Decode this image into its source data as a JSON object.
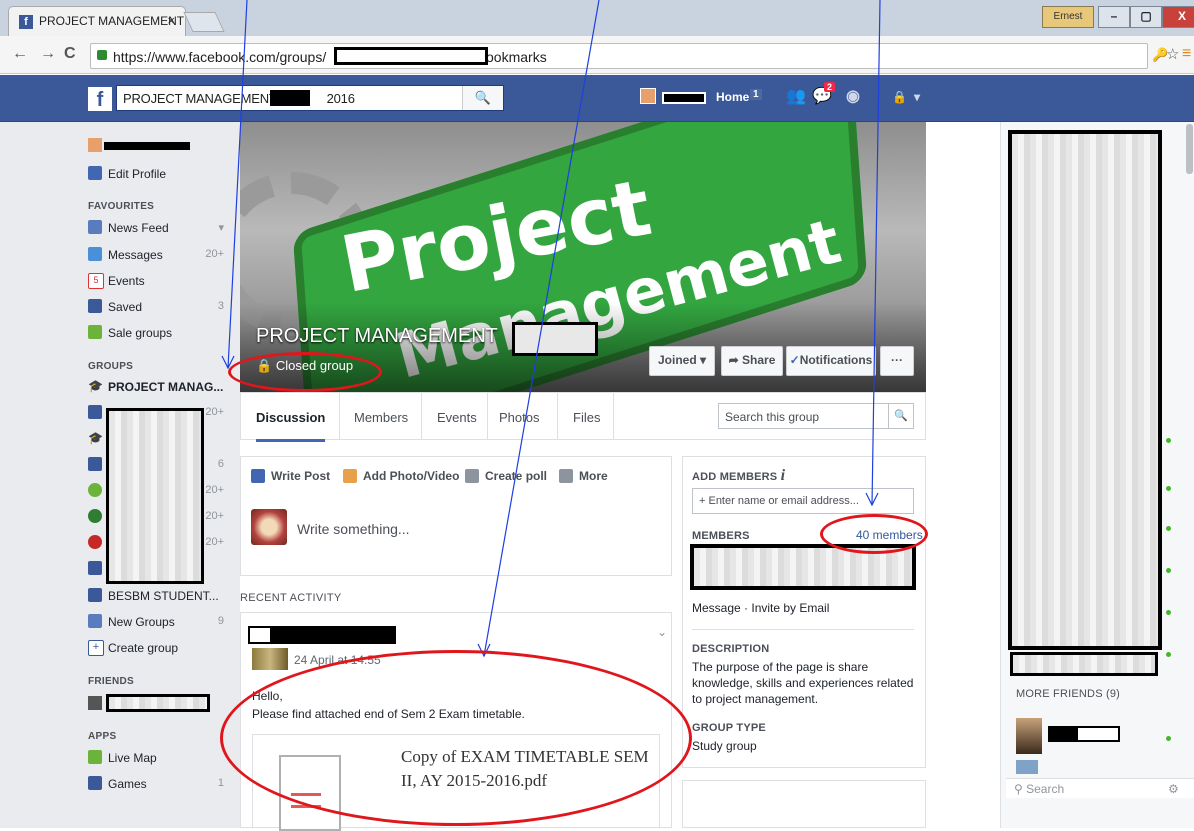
{
  "browser": {
    "tab_title": "PROJECT MANAGEMENT",
    "tab_close": "×",
    "user_badge": "Ernest",
    "url": "https://www.facebook.com/groups/",
    "url_suffix": "bookmarks",
    "minimize": "–",
    "restore": "▢",
    "close": "X"
  },
  "fb_header": {
    "logo": "f",
    "search_value": "PROJECT MANAGEMENT",
    "search_value_tail": "2016",
    "home_label": "Home",
    "home_count": "1",
    "notif_count": "2"
  },
  "left_nav": {
    "edit_profile": "Edit Profile",
    "favourites_heading": "FAVOURITES",
    "favourites": [
      {
        "label": "News Feed",
        "count": "▾",
        "icon_color": "#5b7bbf"
      },
      {
        "label": "Messages",
        "count": "20+",
        "icon_color": "#4a90d9"
      },
      {
        "label": "Events",
        "count": "",
        "icon_color": "#d33"
      },
      {
        "label": "Saved",
        "count": "3",
        "icon_color": "#3b5998"
      },
      {
        "label": "Sale groups",
        "count": "",
        "icon_color": "#6bb33a"
      }
    ],
    "events_icon_text": "5",
    "groups_heading": "GROUPS",
    "groups_first": "PROJECT MANAG...",
    "groups_counts": [
      "20+",
      "",
      "6",
      "20+",
      "20+",
      "20+",
      ""
    ],
    "groups_besbm": "BESBM STUDENT...",
    "new_groups": "New Groups",
    "new_groups_count": "9",
    "create_group": "Create group",
    "friends_heading": "FRIENDS",
    "apps_heading": "APPS",
    "apps": [
      {
        "label": "Live Map",
        "count": ""
      },
      {
        "label": "Games",
        "count": "1"
      }
    ]
  },
  "cover": {
    "word1": "Project",
    "word2": "Management",
    "group_name": "PROJECT MANAGEMENT",
    "group_type": "Closed group",
    "joined": "Joined ▾",
    "share": "Share",
    "notifications": "Notifications",
    "more": "···"
  },
  "group_tabs": [
    "Discussion",
    "Members",
    "Events",
    "Photos",
    "Files"
  ],
  "group_search_placeholder": "Search this group",
  "composer": {
    "write_post": "Write Post",
    "add_photo": "Add Photo/Video",
    "create_poll": "Create poll",
    "more": "More",
    "placeholder": "Write something..."
  },
  "recent_activity": "RECENT ACTIVITY",
  "post": {
    "timestamp": "24 April at 14:55",
    "greeting": "Hello,",
    "body": "Please find attached end of Sem 2 Exam timetable.",
    "attachment_title": "Copy of EXAM TIMETABLE SEM II, AY 2015-2016.pdf"
  },
  "info_panel": {
    "add_members_heading": "ADD MEMBERS",
    "add_members_placeholder": "+ Enter name or email address...",
    "members_heading": "MEMBERS",
    "members_count": "40 members",
    "message_invite": "Message · Invite by Email",
    "description_heading": "DESCRIPTION",
    "description": "The purpose of the page is share knowledge, skills and experiences related to project management.",
    "group_type_heading": "GROUP TYPE",
    "group_type": "Study group"
  },
  "chat": {
    "more_friends": "MORE FRIENDS (9)",
    "search_placeholder": "Search"
  },
  "colors": {
    "fb_blue": "#3b5998",
    "annotation_red": "#e0161c",
    "annotation_arrow": "#1f3fe0",
    "cover_green": "#33a640"
  }
}
